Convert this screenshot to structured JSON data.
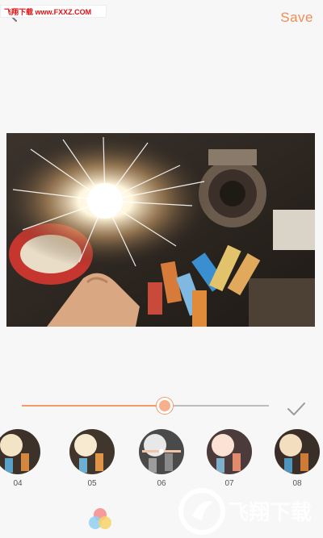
{
  "header": {
    "watermark_text": "飞翔下载 www.FXXZ.COM",
    "save_label": "Save"
  },
  "editor": {
    "intensity_percent": 58
  },
  "filters": [
    {
      "label": "04"
    },
    {
      "label": "05"
    },
    {
      "label": "06"
    },
    {
      "label": "07"
    },
    {
      "label": "08"
    }
  ],
  "footer": {
    "watermark_text": "飞翔下载 www.FXXZ.COM"
  },
  "colors": {
    "accent": "#f08c52",
    "slider_fill": "#f39a6a",
    "palette": [
      "#f58b8b",
      "#8fd0f2",
      "#f7d46a"
    ]
  },
  "icons": {
    "back": "arrow-left-icon",
    "confirm": "checkmark-icon",
    "palette": "color-palette-icon"
  }
}
